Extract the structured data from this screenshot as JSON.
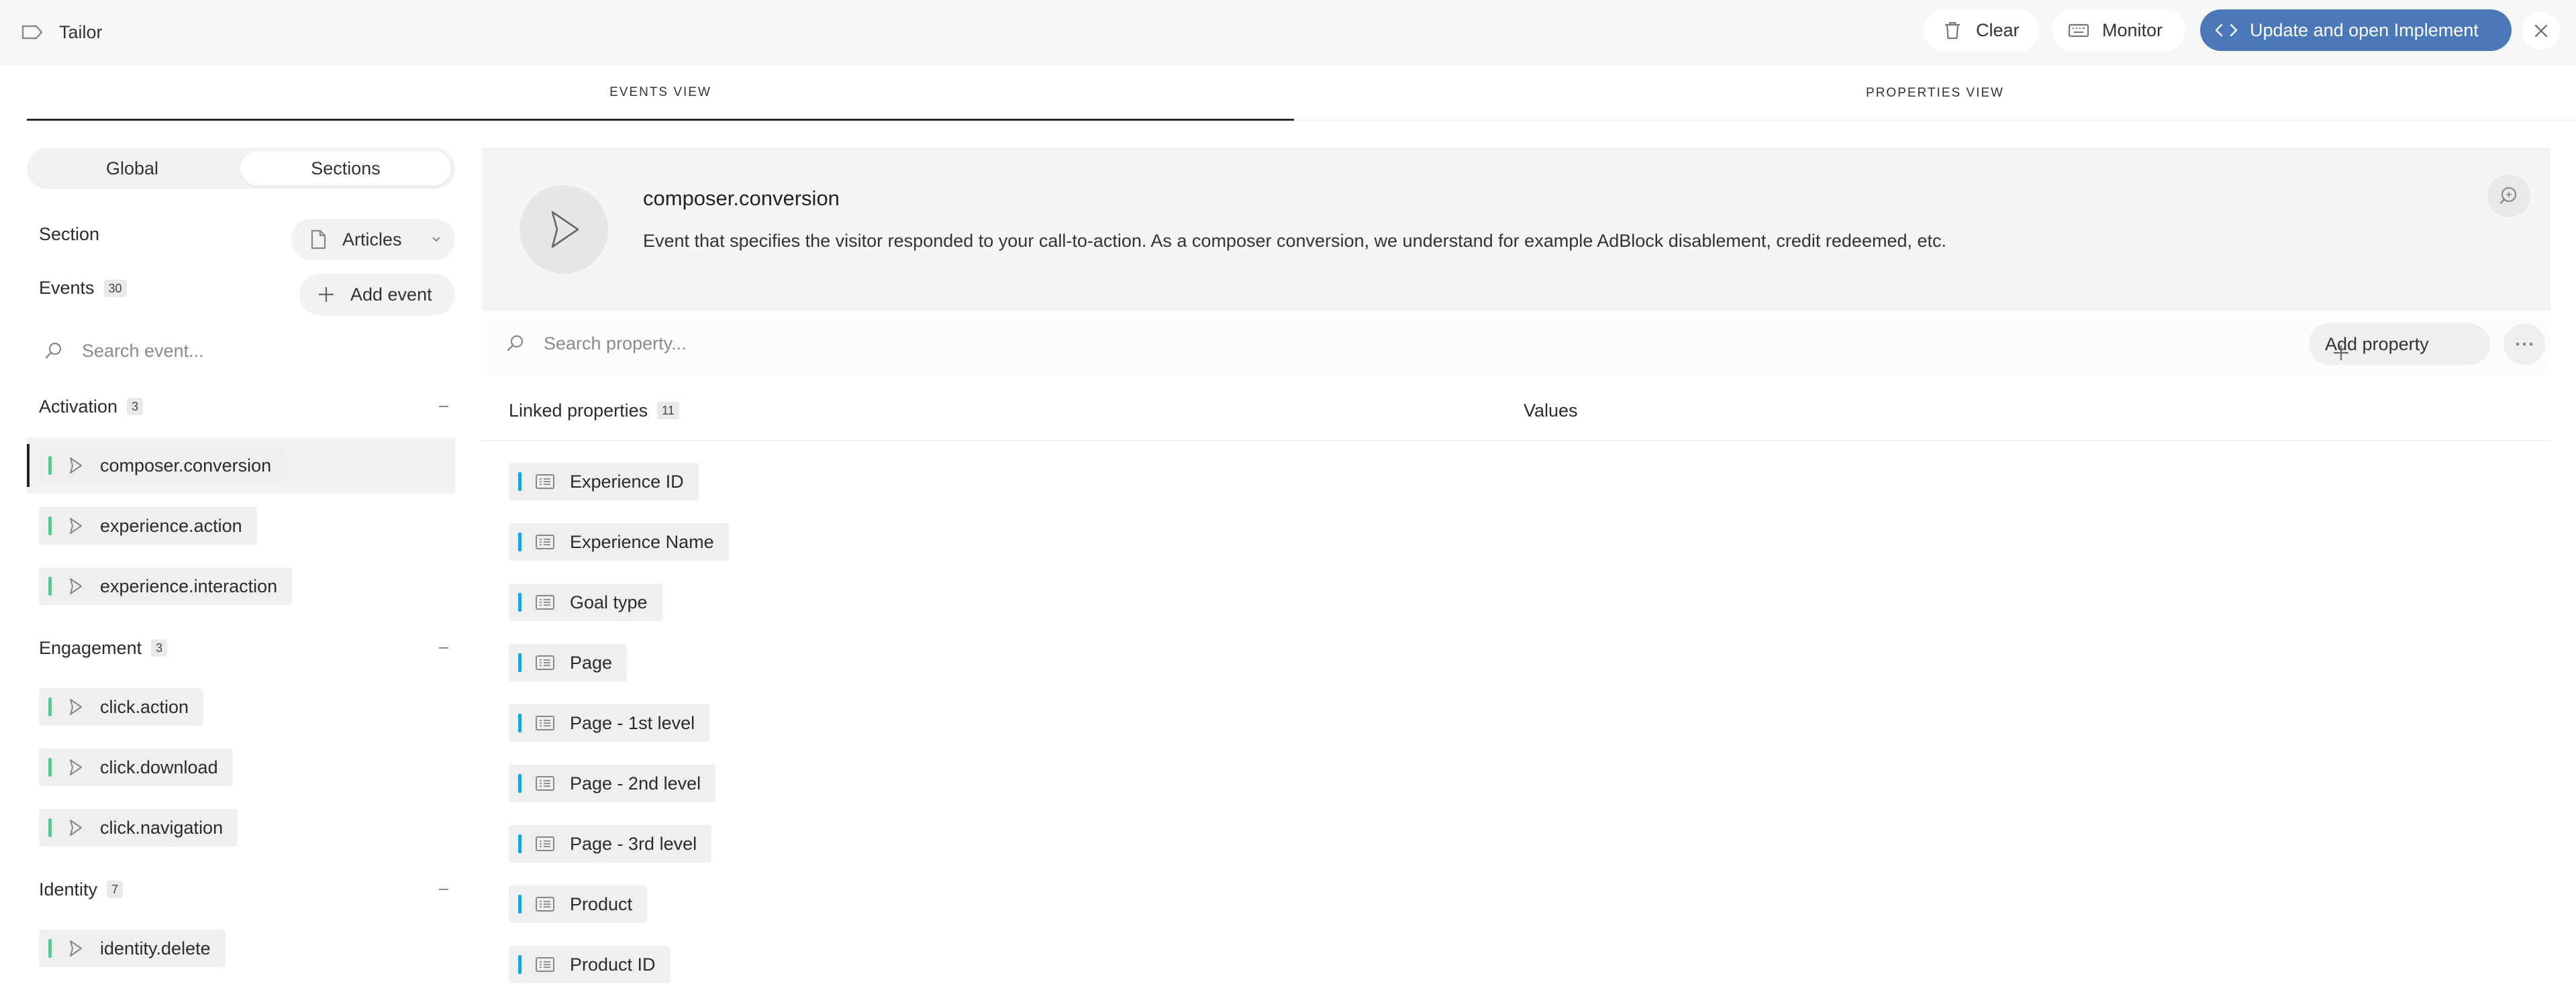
{
  "app": {
    "title": "Tailor",
    "icon": "tag-icon"
  },
  "toolbar": {
    "clear_label": "Clear",
    "monitor_label": "Monitor",
    "primary_label": "Update and open Implement",
    "primary_color": "#4a78b8"
  },
  "view_tabs": [
    {
      "label": "EVENTS VIEW",
      "active": true
    },
    {
      "label": "PROPERTIES VIEW",
      "active": false
    }
  ],
  "sidebar": {
    "scope_toggle": {
      "options": [
        "Global",
        "Sections"
      ],
      "selected": "Sections"
    },
    "section_label": "Section",
    "section_value": "Articles",
    "events_label": "Events",
    "events_count": "30",
    "add_event_label": "Add event",
    "search_placeholder": "Search event...",
    "groups": [
      {
        "name": "Activation",
        "count": "3",
        "events": [
          "composer.conversion",
          "experience.action",
          "experience.interaction"
        ]
      },
      {
        "name": "Engagement",
        "count": "3",
        "events": [
          "click.action",
          "click.download",
          "click.navigation"
        ]
      },
      {
        "name": "Identity",
        "count": "7",
        "events": [
          "identity.delete"
        ]
      }
    ],
    "selected_event": "composer.conversion",
    "event_bar_color": "#5cc694"
  },
  "event_detail": {
    "name": "composer.conversion",
    "description": "Event that specifies the visitor responded to your call-to-action. As a composer conversion, we understand for example AdBlock disablement, credit redeemed, etc."
  },
  "properties": {
    "search_placeholder": "Search property...",
    "add_property_label": "Add property",
    "linked_label": "Linked properties",
    "linked_count": "11",
    "values_label": "Values",
    "items": [
      "Experience ID",
      "Experience Name",
      "Goal type",
      "Page",
      "Page - 1st level",
      "Page - 2nd level",
      "Page - 3rd level",
      "Product",
      "Product ID"
    ],
    "bar_color": "#1aa3e0"
  }
}
